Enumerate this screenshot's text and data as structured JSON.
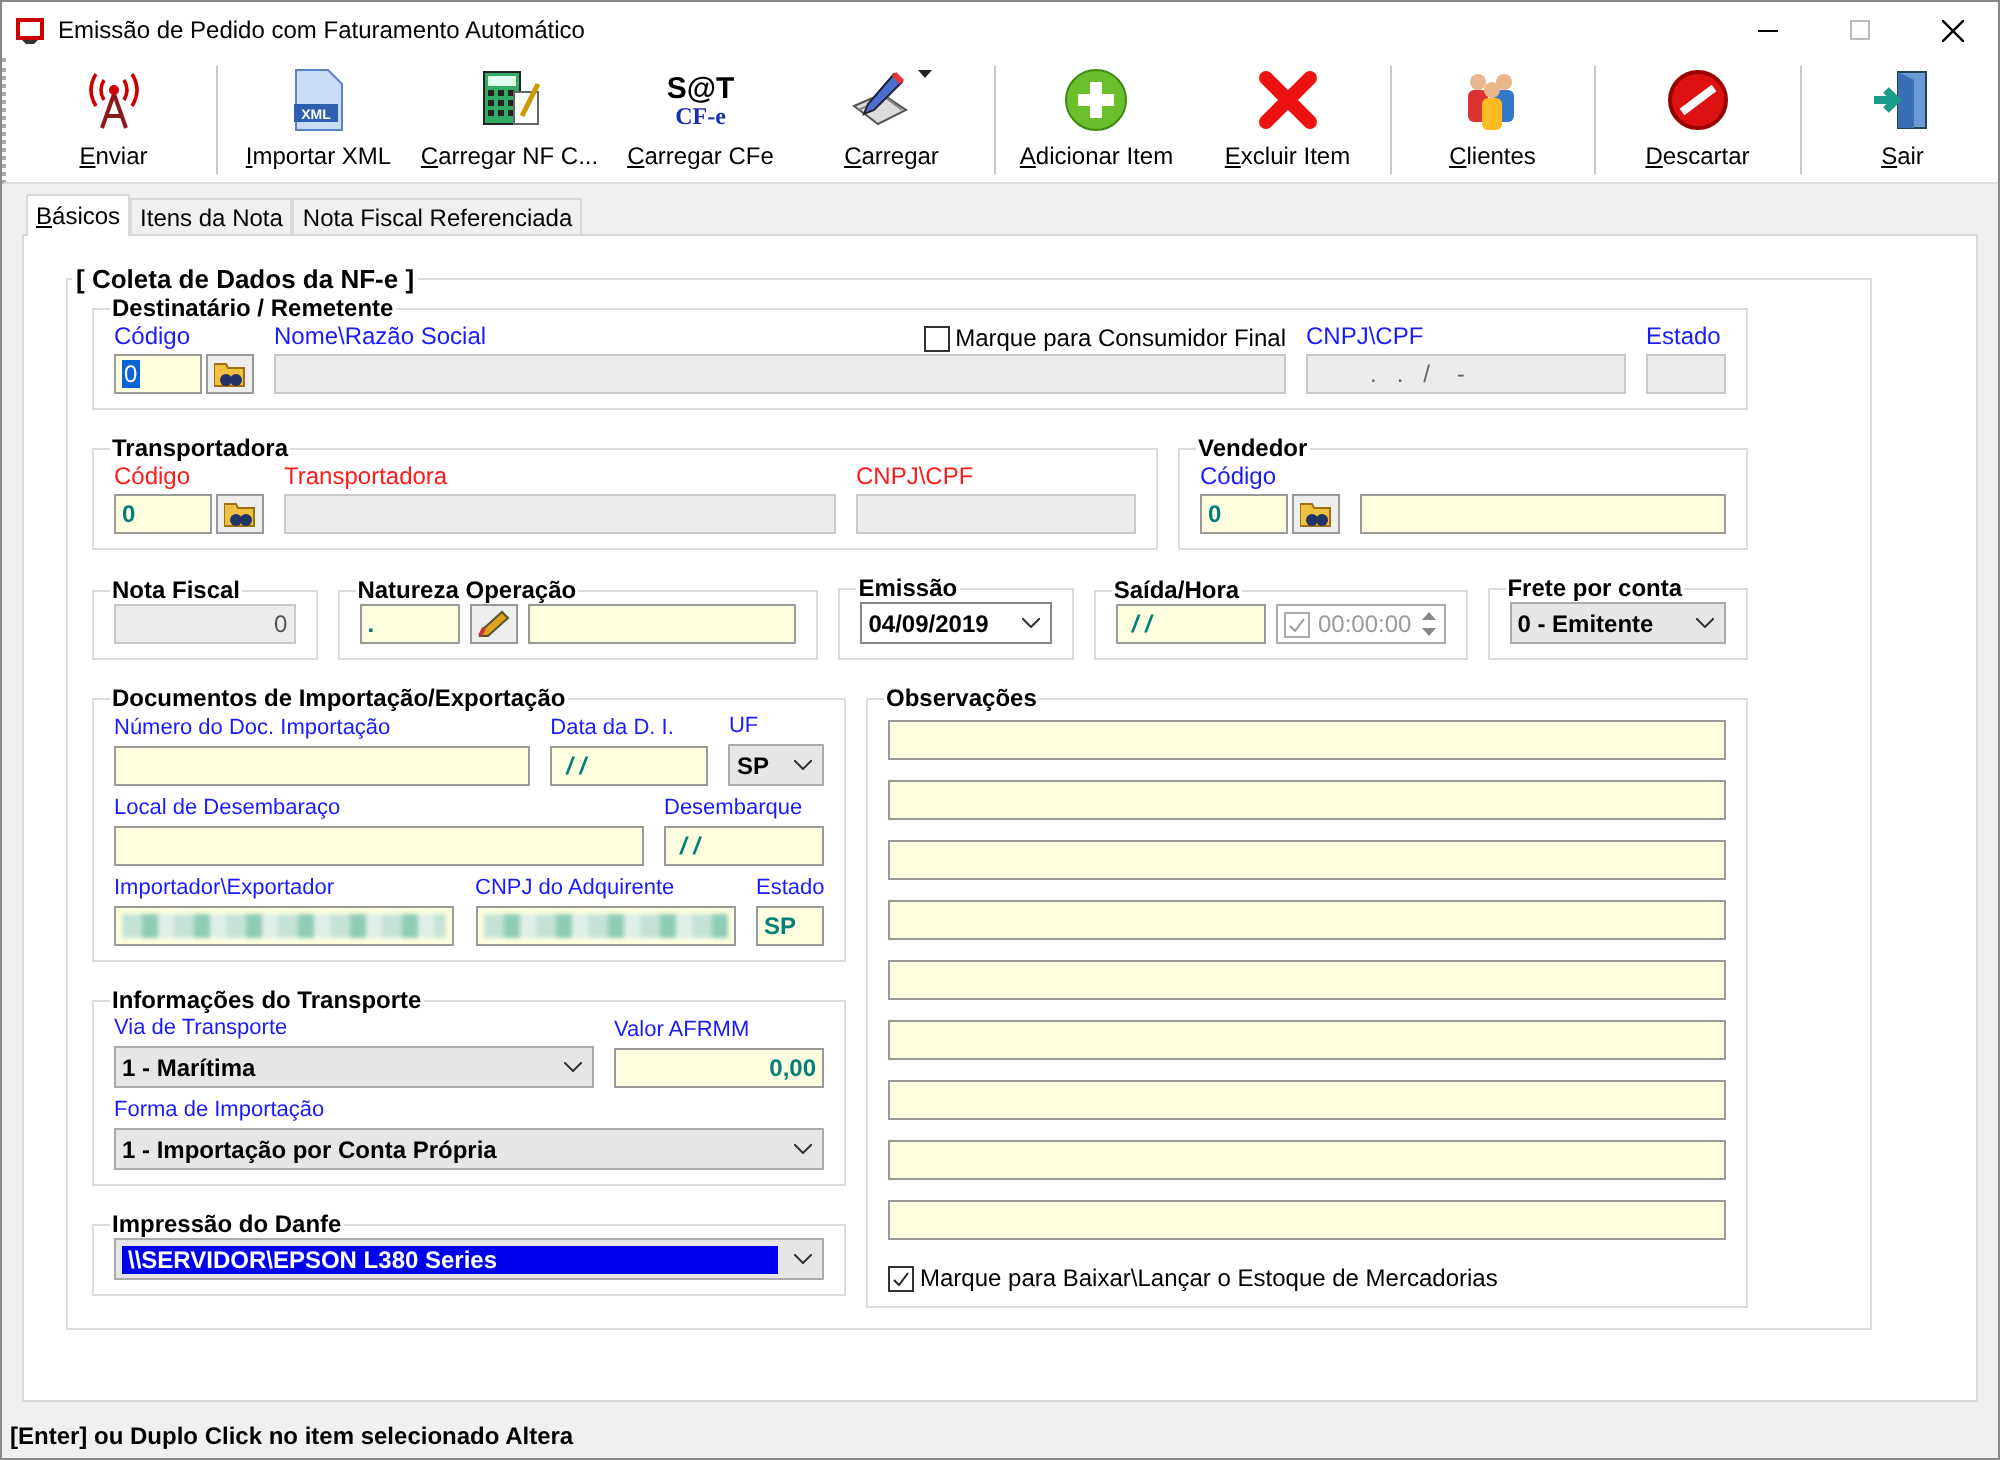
{
  "window": {
    "title": "Emissão de Pedido com Faturamento Automático"
  },
  "toolbar_groups": [
    {
      "items": [
        {
          "label": "Enviar",
          "kind": "antenna"
        }
      ]
    },
    {
      "items": [
        {
          "label": "Importar XML",
          "kind": "xml",
          "icon_text": "XML"
        },
        {
          "label": "Carregar NF C...",
          "kind": "calculator"
        },
        {
          "label": "Carregar CFe",
          "kind": "sat",
          "icon_text": "S@T",
          "icon_subtext": "CF-e"
        },
        {
          "label": "Carregar",
          "kind": "pen",
          "dropdown": true
        }
      ]
    },
    {
      "items": [
        {
          "label": "Adicionar Item",
          "kind": "add"
        },
        {
          "label": "Excluir Item",
          "kind": "delete"
        }
      ]
    },
    {
      "items": [
        {
          "label": "Clientes",
          "kind": "clients"
        }
      ]
    },
    {
      "items": [
        {
          "label": "Descartar",
          "kind": "discard"
        }
      ]
    },
    {
      "items": [
        {
          "label": "Sair",
          "kind": "exit"
        }
      ]
    }
  ],
  "tabs": [
    {
      "label": "Básicos",
      "selected": true
    },
    {
      "label": "Itens da Nota",
      "selected": false
    },
    {
      "label": "Nota Fiscal Referenciada",
      "selected": false
    }
  ],
  "form": {
    "title": "[ Coleta de Dados da NF-e ]",
    "destinatario": {
      "title": "Destinatário / Remetente",
      "consumer_checkbox": {
        "label": "Marque para Consumidor Final",
        "checked": false
      },
      "codigo": {
        "label": "Código",
        "value": "0",
        "focused": true,
        "readonly": false
      },
      "nome": {
        "label": "Nome\\Razão Social",
        "readonly": true
      },
      "cnpj": {
        "label": "CNPJ\\CPF",
        "value": ".   .   /    -",
        "readonly": true
      },
      "estado": {
        "label": "Estado",
        "readonly": true
      }
    },
    "transportadora": {
      "title": "Transportadora",
      "required": true,
      "codigo": {
        "label": "Código",
        "value": "0",
        "readonly": false
      },
      "nome": {
        "label": "Transportadora",
        "readonly": true
      },
      "cnpj": {
        "label": "CNPJ\\CPF",
        "readonly": true
      }
    },
    "vendedor": {
      "title": "Vendedor",
      "codigo": {
        "label": "Código",
        "value": "0",
        "readonly": false
      },
      "nome": {
        "readonly": false
      }
    },
    "nota_fiscal": {
      "title": "Nota Fiscal",
      "value": "0",
      "readonly": true
    },
    "natureza": {
      "title": "Natureza Operação",
      "code": {
        "value": ".",
        "readonly": false
      },
      "description": {
        "readonly": false
      }
    },
    "emissao": {
      "title": "Emissão",
      "value": "04/09/2019"
    },
    "saida": {
      "title": "Saída/Hora",
      "date": {
        "value": "/ /",
        "readonly": false
      },
      "time": {
        "value": "00:00:00",
        "checked": true,
        "disabled": true
      }
    },
    "frete": {
      "title": "Frete por conta",
      "value": "0 - Emitente"
    },
    "documentos": {
      "title": "Documentos de Importação/Exportação",
      "numero": {
        "label": "Número do Doc. Importação",
        "readonly": false
      },
      "data_di": {
        "label": "Data da D. I.",
        "value": "/ /",
        "readonly": false
      },
      "uf": {
        "label": "UF",
        "value": "SP"
      },
      "local": {
        "label": "Local de Desembaraço",
        "readonly": false
      },
      "desembarque": {
        "label": "Desembarque",
        "value": "/ /",
        "readonly": false
      },
      "importador": {
        "label": "Importador\\Exportador",
        "redacted": true,
        "readonly": false
      },
      "cnpj_adquirente": {
        "label": "CNPJ do Adquirente",
        "redacted": true,
        "readonly": false
      },
      "estado": {
        "label": "Estado",
        "value": "SP",
        "readonly": false
      }
    },
    "transporte": {
      "title": "Informações do Transporte",
      "via": {
        "label": "Via de Transporte",
        "value": "1 - Marítima"
      },
      "afrmm": {
        "label": "Valor AFRMM",
        "value": "0,00",
        "readonly": false
      },
      "forma": {
        "label": "Forma de Importação",
        "value": "1 - Importação por Conta Própria"
      }
    },
    "danfe": {
      "title": "Impressão do Danfe",
      "value": "\\\\SERVIDOR\\EPSON L380 Series",
      "focused": true
    },
    "observacoes": {
      "title": "Observações",
      "lines": [
        {
          "readonly": false
        },
        {
          "readonly": false
        },
        {
          "readonly": false
        },
        {
          "readonly": false
        },
        {
          "readonly": false
        },
        {
          "readonly": false
        },
        {
          "readonly": false
        },
        {
          "readonly": false
        },
        {
          "readonly": false
        }
      ],
      "stock_checkbox": {
        "label": "Marque para Baixar\\Lançar o Estoque de Mercadorias",
        "checked": true
      }
    }
  },
  "status_bar": {
    "text": "[Enter] ou Duplo Click no item selecionado Altera"
  }
}
